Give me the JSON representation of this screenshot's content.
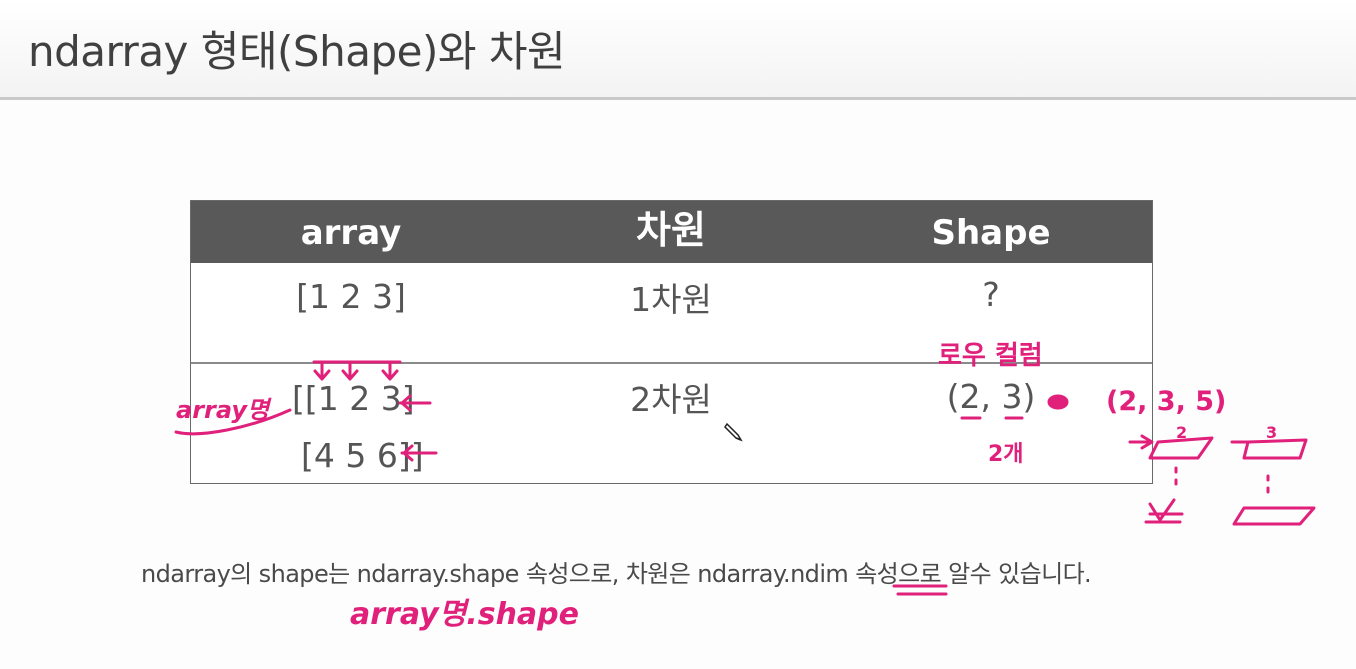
{
  "slide": {
    "title": "ndarray 형태(Shape)와 차원"
  },
  "table": {
    "headers": [
      "array",
      "차원",
      "Shape"
    ],
    "rows": [
      {
        "array_lines": [
          "[1 2 3]"
        ],
        "dimension": "1차원",
        "shape": "?"
      },
      {
        "array_lines": [
          "[[1 2 3]",
          "[4 5 6]]"
        ],
        "dimension": "2차원",
        "shape": "(2, 3)"
      }
    ]
  },
  "caption": "ndarray의 shape는 ndarray.shape 속성으로, 차원은 ndarray.ndim 속성으로 알수 있습니다.",
  "annotations": {
    "ink_color": "#e0207a",
    "rows_cols_note": "로우 컬럼",
    "array_name_note": "array명",
    "count_note": "2개",
    "shape_note": "array명.shape",
    "shape_3d_note": "(2, 3, 5)",
    "shape_3d_numbers": [
      "2",
      "3",
      "5"
    ]
  }
}
